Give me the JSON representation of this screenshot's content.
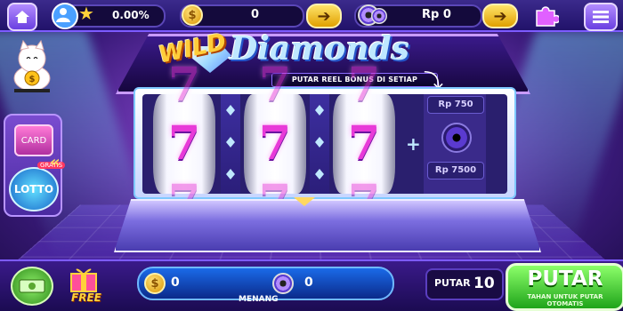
{
  "topbar": {
    "level_progress": "0.00%",
    "coin_balance": "0",
    "rp_balance": "Rp 0"
  },
  "left_panel": {
    "card_label": "CARD",
    "lotto_label": "LOTTO",
    "gratis_label": "GRATIS"
  },
  "game": {
    "logo_wild": "WILD",
    "logo_diamonds": "Diamonds",
    "banner": "PUTAR REEL BONUS DI SETIAP KEMENANGAN!",
    "reels": [
      "7",
      "7",
      "7"
    ],
    "bonus_values": [
      "Rp 750",
      "Rp 7500"
    ]
  },
  "bottombar": {
    "free_label": "FREE",
    "win_coins": "0",
    "win_discs": "0",
    "win_label": "MENANG",
    "spin_label": "PUTAR",
    "spin_count": "10",
    "spin_button_label": "PUTAR",
    "spin_button_sub": "TAHAN UNTUK PUTAR OTOMATIS"
  },
  "colors": {
    "accent": "#7d5bff",
    "seven": "#e83ad8",
    "spin_green": "#1fa41a",
    "coin_gold": "#ffcd3a"
  }
}
